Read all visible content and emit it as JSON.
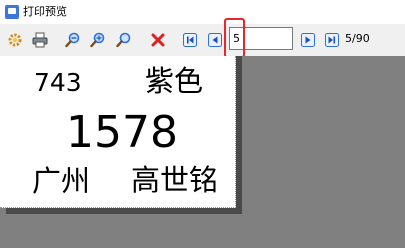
{
  "window": {
    "title": "打印预览"
  },
  "toolbar": {
    "buttons": [
      {
        "name": "page-setup-button",
        "icon": "gear-icon"
      },
      {
        "name": "print-button",
        "icon": "printer-icon"
      },
      {
        "name": "zoom-out-button",
        "icon": "zoom-out-icon"
      },
      {
        "name": "zoom-in-button",
        "icon": "zoom-in-icon"
      },
      {
        "name": "zoom-fit-button",
        "icon": "magnifier-icon"
      },
      {
        "name": "close-button",
        "icon": "close-icon"
      },
      {
        "name": "first-page-button",
        "icon": "first-page-icon"
      },
      {
        "name": "prev-page-button",
        "icon": "prev-page-icon"
      },
      {
        "name": "next-page-button",
        "icon": "next-page-icon"
      },
      {
        "name": "last-page-button",
        "icon": "last-page-icon"
      }
    ],
    "page_input_value": "5",
    "page_count": "5/90",
    "colors": {
      "highlight": "#e8272a",
      "nav_blue": "#2f6fd6",
      "close_red": "#e02020"
    }
  },
  "label": {
    "code": "743",
    "color": "紫色",
    "number": "1578",
    "city": "广州",
    "name": "高世铭"
  }
}
